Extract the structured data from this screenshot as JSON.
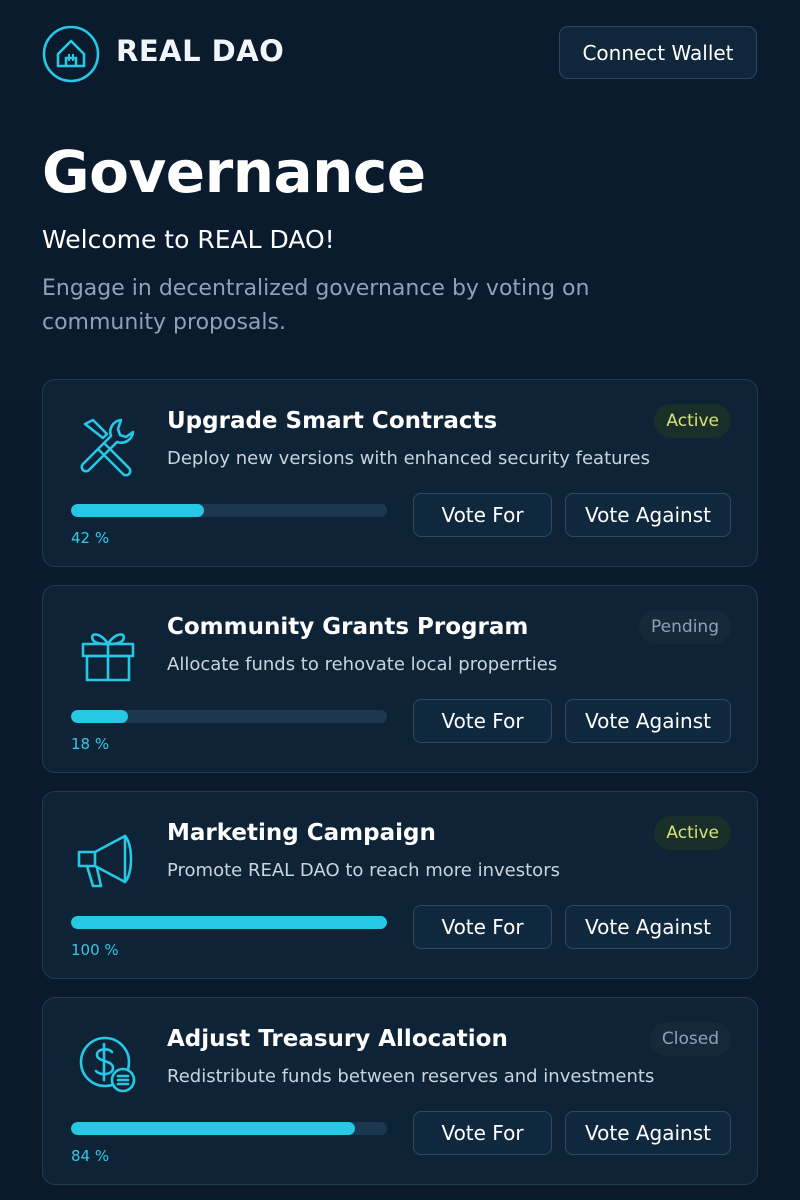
{
  "app": {
    "name": "REAL DAO",
    "logo_icon": "house-logo-icon",
    "connect_wallet_label": "Connect Wallet"
  },
  "hero": {
    "title": "Governance",
    "welcome": "Welcome to REAL DAO!",
    "intro": "Engage in decentralized governance by voting on community proposals."
  },
  "colors": {
    "accent": "#27c7e6",
    "background": "#0b1b2e",
    "card": "#0e2336",
    "active_badge_text": "#d7e27a",
    "muted_text": "#8ea2b6"
  },
  "proposals": [
    {
      "title": "Upgrade Smart Contracts",
      "description": "Deploy new versions with enhanced security features",
      "status": "Active",
      "icon": "wrench-screwdriver-icon",
      "progress": 42,
      "progress_label": "42 %",
      "vote_for_label": "Vote For",
      "vote_against_label": "Vote Against"
    },
    {
      "title": "Community Grants Program",
      "description": "Allocate funds to rehovate local properrties",
      "status": "Pending",
      "icon": "gift-icon",
      "progress": 18,
      "progress_label": "18 %",
      "vote_for_label": "Vote For",
      "vote_against_label": "Vote Against"
    },
    {
      "title": "Marketing Campaign",
      "description": "Promote REAL DAO to reach more investors",
      "status": "Active",
      "icon": "megaphone-icon",
      "progress": 100,
      "progress_label": "100 %",
      "vote_for_label": "Vote For",
      "vote_against_label": "Vote Against"
    },
    {
      "title": "Adjust Treasury Allocation",
      "description": "Redistribute funds between reserves and investments",
      "status": "Closed",
      "icon": "dollar-coin-icon",
      "progress": 90,
      "progress_label": "84 %",
      "vote_for_label": "Vote For",
      "vote_against_label": "Vote Against"
    }
  ]
}
